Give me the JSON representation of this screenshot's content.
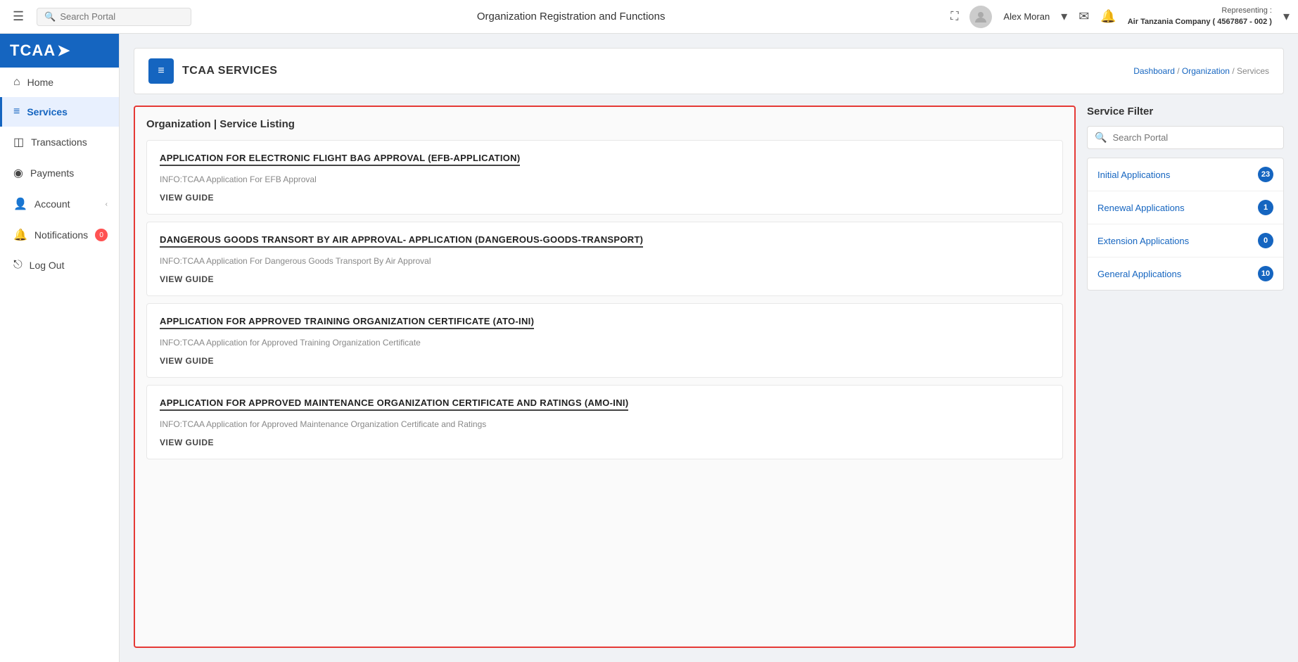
{
  "header": {
    "hamburger_label": "☰",
    "search_placeholder": "Search Portal",
    "page_title": "Organization Registration and Functions",
    "fullscreen_icon": "⛶",
    "user_name": "Alex Moran",
    "user_chevron": "▾",
    "mail_icon": "✉",
    "bell_icon": "🔔",
    "representing_label": "Representing :",
    "representing_value": "Air Tanzania Company ( 4567867 - 002 )",
    "dropdown_icon": "▾"
  },
  "sidebar": {
    "logo_text": "TCAA",
    "logo_arrow": "➤",
    "items": [
      {
        "id": "home",
        "icon": "⌂",
        "label": "Home",
        "active": false
      },
      {
        "id": "services",
        "icon": "≡",
        "label": "Services",
        "active": true
      },
      {
        "id": "transactions",
        "icon": "◫",
        "label": "Transactions",
        "active": false
      },
      {
        "id": "payments",
        "icon": "◉",
        "label": "Payments",
        "active": false
      },
      {
        "id": "account",
        "icon": "👤",
        "label": "Account",
        "active": false,
        "chevron": "‹"
      },
      {
        "id": "notifications",
        "icon": "🔔",
        "label": "Notifications",
        "active": false,
        "badge": "0"
      },
      {
        "id": "logout",
        "icon": "⎋",
        "label": "Log Out",
        "active": false
      }
    ]
  },
  "page_header": {
    "icon": "≡",
    "title": "TCAA SERVICES",
    "breadcrumb": [
      {
        "label": "Dashboard",
        "link": true
      },
      {
        "label": "Organization",
        "link": true
      },
      {
        "label": "Services",
        "link": false
      }
    ]
  },
  "service_listing": {
    "heading": "Organization | Service Listing",
    "services": [
      {
        "title": "APPLICATION FOR ELECTRONIC FLIGHT BAG APPROVAL (EFB-APPLICATION)",
        "info": "INFO:TCAA Application For EFB Approval",
        "guide_label": "VIEW GUIDE"
      },
      {
        "title": "DANGEROUS GOODS TRANSORT BY AIR APPROVAL- APPLICATION (DANGEROUS-GOODS-TRANSPORT)",
        "info": "INFO:TCAA Application For Dangerous Goods Transport By Air Approval",
        "guide_label": "VIEW GUIDE"
      },
      {
        "title": "APPLICATION FOR APPROVED TRAINING ORGANIZATION CERTIFICATE (ATO-INI)",
        "info": "INFO:TCAA Application for Approved Training Organization Certificate",
        "guide_label": "VIEW GUIDE"
      },
      {
        "title": "APPLICATION FOR APPROVED MAINTENANCE ORGANIZATION CERTIFICATE AND RATINGS (AMO-INI)",
        "info": "INFO:TCAA Application for Approved Maintenance Organization Certificate and Ratings",
        "guide_label": "VIEW GUIDE"
      }
    ]
  },
  "filter": {
    "title": "Service Filter",
    "search_placeholder": "Search Portal",
    "items": [
      {
        "label": "Initial Applications",
        "count": "23"
      },
      {
        "label": "Renewal Applications",
        "count": "1"
      },
      {
        "label": "Extension Applications",
        "count": "0"
      },
      {
        "label": "General Applications",
        "count": "10"
      }
    ]
  }
}
